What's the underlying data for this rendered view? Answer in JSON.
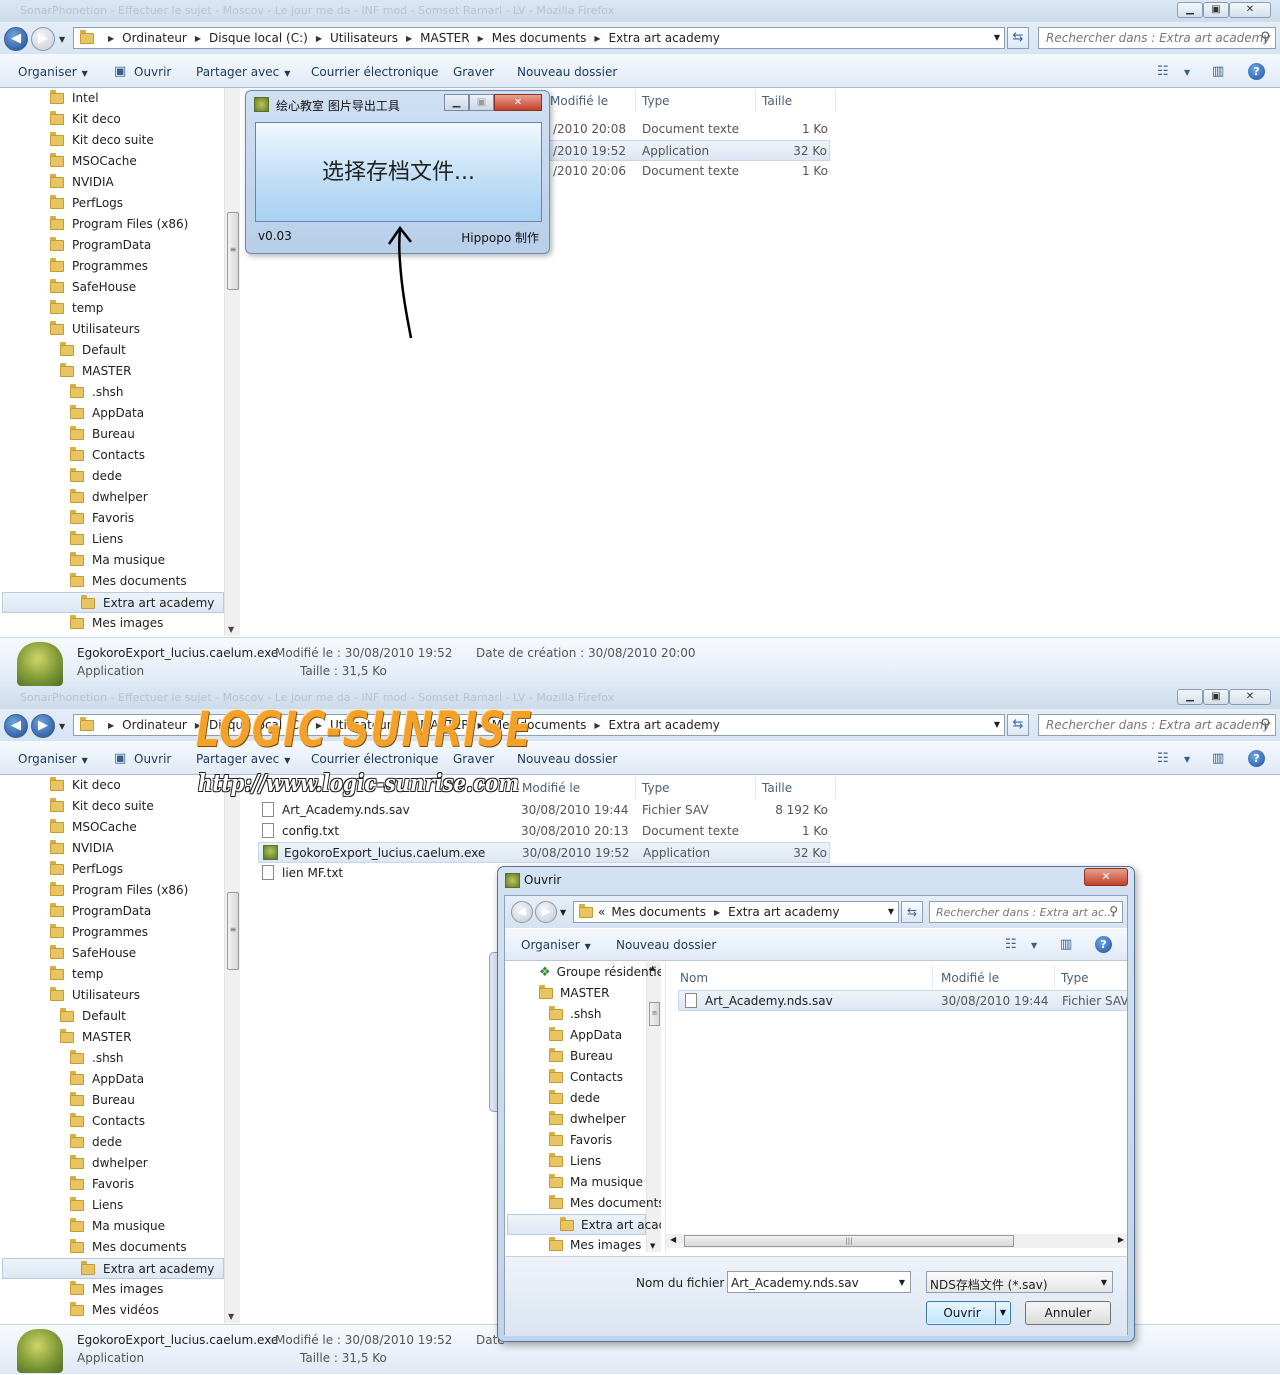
{
  "top": {
    "window_faded_title": "SonarPhonetion - Effectuer le sujet - Moscov - Le jour me da - INF mod - Somset Ramarl - LV - Mozilla Firefox",
    "address": {
      "crumbs": [
        "Ordinateur",
        "Disque local (C:)",
        "Utilisateurs",
        "MASTER",
        "Mes documents",
        "Extra art academy"
      ]
    },
    "search_placeholder": "Rechercher dans : Extra art academy",
    "toolbar": {
      "organize": "Organiser",
      "open": "Ouvrir",
      "share": "Partager avec",
      "email": "Courrier électronique",
      "burn": "Graver",
      "new_folder": "Nouveau dossier"
    },
    "tree": [
      {
        "label": "Intel",
        "indent": 0
      },
      {
        "label": "Kit deco",
        "indent": 0
      },
      {
        "label": "Kit deco suite",
        "indent": 0
      },
      {
        "label": "MSOCache",
        "indent": 0,
        "locked": true
      },
      {
        "label": "NVIDIA",
        "indent": 0
      },
      {
        "label": "PerfLogs",
        "indent": 0
      },
      {
        "label": "Program Files (x86)",
        "indent": 0
      },
      {
        "label": "ProgramData",
        "indent": 0
      },
      {
        "label": "Programmes",
        "indent": 0
      },
      {
        "label": "SafeHouse",
        "indent": 0
      },
      {
        "label": "temp",
        "indent": 0
      },
      {
        "label": "Utilisateurs",
        "indent": 0
      },
      {
        "label": "Default",
        "indent": 1
      },
      {
        "label": "MASTER",
        "indent": 1,
        "locked": true
      },
      {
        "label": ".shsh",
        "indent": 2
      },
      {
        "label": "AppData",
        "indent": 2
      },
      {
        "label": "Bureau",
        "indent": 2
      },
      {
        "label": "Contacts",
        "indent": 2
      },
      {
        "label": "dede",
        "indent": 2
      },
      {
        "label": "dwhelper",
        "indent": 2
      },
      {
        "label": "Favoris",
        "indent": 2
      },
      {
        "label": "Liens",
        "indent": 2
      },
      {
        "label": "Ma musique",
        "indent": 2
      },
      {
        "label": "Mes documents",
        "indent": 2
      },
      {
        "label": "Extra art academy",
        "indent": 3,
        "selected": true
      },
      {
        "label": "Mes images",
        "indent": 2
      }
    ],
    "columns": {
      "modified": "Modifié le",
      "type": "Type",
      "size": "Taille"
    },
    "rows": [
      {
        "modified": "/2010 20:08",
        "type": "Document texte",
        "size": "1 Ko"
      },
      {
        "modified": "/2010 19:52",
        "type": "Application",
        "size": "32 Ko",
        "selected": true
      },
      {
        "modified": "/2010 20:06",
        "type": "Document texte",
        "size": "1 Ko"
      }
    ],
    "app_window": {
      "title": "绘心教室 图片导出工具",
      "button": "选择存档文件...",
      "version": "v0.03",
      "credit": "Hippopo 制作"
    },
    "details": {
      "filename": "EgokoroExport_lucius.caelum.exe",
      "kind": "Application",
      "modified": "Modifié le : 30/08/2010 19:52",
      "size": "Taille : 31,5 Ko",
      "created": "Date de création : 30/08/2010 20:00"
    }
  },
  "bottom": {
    "window_faded_title": "SonarPhonetion - Effectuer le sujet - Moscov - Le jour me da - INF mod - Somset Ramarl - LV - Mozilla Firefox",
    "address": {
      "crumbs": [
        "Ordinateur",
        "Disque local (C:)",
        "Utilisateurs",
        "MASTER",
        "Mes documents",
        "Extra art academy"
      ]
    },
    "search_placeholder": "Rechercher dans : Extra art academy",
    "toolbar": {
      "organize": "Organiser",
      "open": "Ouvrir",
      "share": "Partager avec",
      "email": "Courrier électronique",
      "burn": "Graver",
      "new_folder": "Nouveau dossier"
    },
    "tree": [
      {
        "label": "Kit deco",
        "indent": 0
      },
      {
        "label": "Kit deco suite",
        "indent": 0
      },
      {
        "label": "MSOCache",
        "indent": 0,
        "locked": true
      },
      {
        "label": "NVIDIA",
        "indent": 0
      },
      {
        "label": "PerfLogs",
        "indent": 0
      },
      {
        "label": "Program Files (x86)",
        "indent": 0
      },
      {
        "label": "ProgramData",
        "indent": 0
      },
      {
        "label": "Programmes",
        "indent": 0
      },
      {
        "label": "SafeHouse",
        "indent": 0
      },
      {
        "label": "temp",
        "indent": 0
      },
      {
        "label": "Utilisateurs",
        "indent": 0
      },
      {
        "label": "Default",
        "indent": 1
      },
      {
        "label": "MASTER",
        "indent": 1,
        "locked": true
      },
      {
        "label": ".shsh",
        "indent": 2
      },
      {
        "label": "AppData",
        "indent": 2
      },
      {
        "label": "Bureau",
        "indent": 2
      },
      {
        "label": "Contacts",
        "indent": 2
      },
      {
        "label": "dede",
        "indent": 2
      },
      {
        "label": "dwhelper",
        "indent": 2
      },
      {
        "label": "Favoris",
        "indent": 2
      },
      {
        "label": "Liens",
        "indent": 2
      },
      {
        "label": "Ma musique",
        "indent": 2
      },
      {
        "label": "Mes documents",
        "indent": 2
      },
      {
        "label": "Extra art academy",
        "indent": 3,
        "selected": true
      },
      {
        "label": "Mes images",
        "indent": 2
      },
      {
        "label": "Mes vidéos",
        "indent": 2
      }
    ],
    "columns": {
      "modified": "Modifié le",
      "type": "Type",
      "size": "Taille"
    },
    "rows": [
      {
        "name": "Art_Academy.nds.sav",
        "modified": "30/08/2010 19:44",
        "type": "Fichier SAV",
        "size": "8 192 Ko",
        "icon": "file"
      },
      {
        "name": "config.txt",
        "modified": "30/08/2010 20:13",
        "type": "Document texte",
        "size": "1 Ko",
        "icon": "file"
      },
      {
        "name": "EgokoroExport_lucius.caelum.exe",
        "modified": "30/08/2010 19:52",
        "type": "Application",
        "size": "32 Ko",
        "icon": "exe",
        "selected": true
      },
      {
        "name": "lien MF.txt",
        "modified": "",
        "type": "",
        "size": "",
        "icon": "file"
      }
    ],
    "details": {
      "filename": "EgokoroExport_lucius.caelum.exe",
      "kind": "Application",
      "modified": "Modifié le : 30/08/2010 19:52",
      "size": "Taille : 31,5 Ko",
      "created": "Date"
    },
    "watermark": {
      "line1": "LOGIC-SUNRISE",
      "line2": "http://www.logic-sunrise.com"
    },
    "dialog": {
      "title": "Ouvrir",
      "address": {
        "crumbs": [
          "Mes documents",
          "Extra art academy"
        ]
      },
      "search_placeholder": "Rechercher dans : Extra art ac...",
      "organize": "Organiser",
      "new_folder": "Nouveau dossier",
      "tree": [
        {
          "label": "Groupe résidentiel",
          "indent": 0,
          "icon": "home"
        },
        {
          "label": "MASTER",
          "indent": 0
        },
        {
          "label": ".shsh",
          "indent": 1
        },
        {
          "label": "AppData",
          "indent": 1
        },
        {
          "label": "Bureau",
          "indent": 1
        },
        {
          "label": "Contacts",
          "indent": 1
        },
        {
          "label": "dede",
          "indent": 1
        },
        {
          "label": "dwhelper",
          "indent": 1
        },
        {
          "label": "Favoris",
          "indent": 1
        },
        {
          "label": "Liens",
          "indent": 1
        },
        {
          "label": "Ma musique",
          "indent": 1
        },
        {
          "label": "Mes documents",
          "indent": 1
        },
        {
          "label": "Extra art academy",
          "indent": 2,
          "selected": true
        },
        {
          "label": "Mes images",
          "indent": 1
        }
      ],
      "columns": {
        "name": "Nom",
        "modified": "Modifié le",
        "type": "Type"
      },
      "rows": [
        {
          "name": "Art_Academy.nds.sav",
          "modified": "30/08/2010 19:44",
          "type": "Fichier SAV",
          "selected": true
        }
      ],
      "filename_label": "Nom du fichier :",
      "filename_value": "Art_Academy.nds.sav",
      "filetype": "NDS存档文件 (*.sav)",
      "open_button": "Ouvrir",
      "cancel_button": "Annuler"
    }
  }
}
